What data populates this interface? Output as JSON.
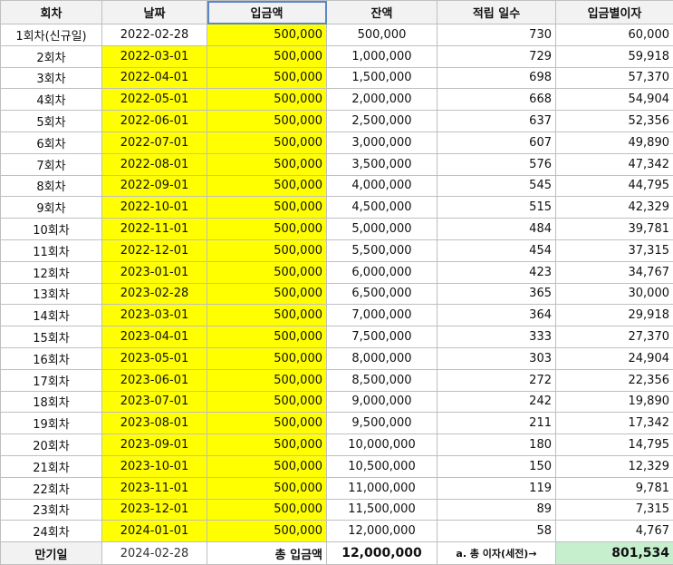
{
  "headers": [
    "회차",
    "날짜",
    "입금액",
    "잔액",
    "적립 일수",
    "입금별이자"
  ],
  "rows": [
    {
      "round": "1회차(신규일)",
      "date": "2022-02-28",
      "deposit": "500,000",
      "balance": "500,000",
      "days": "730",
      "interest": "60,000",
      "highlight_date": false
    },
    {
      "round": "2회차",
      "date": "2022-03-01",
      "deposit": "500,000",
      "balance": "1,000,000",
      "days": "729",
      "interest": "59,918",
      "highlight_date": true
    },
    {
      "round": "3회차",
      "date": "2022-04-01",
      "deposit": "500,000",
      "balance": "1,500,000",
      "days": "698",
      "interest": "57,370",
      "highlight_date": true
    },
    {
      "round": "4회차",
      "date": "2022-05-01",
      "deposit": "500,000",
      "balance": "2,000,000",
      "days": "668",
      "interest": "54,904",
      "highlight_date": true
    },
    {
      "round": "5회차",
      "date": "2022-06-01",
      "deposit": "500,000",
      "balance": "2,500,000",
      "days": "637",
      "interest": "52,356",
      "highlight_date": true
    },
    {
      "round": "6회차",
      "date": "2022-07-01",
      "deposit": "500,000",
      "balance": "3,000,000",
      "days": "607",
      "interest": "49,890",
      "highlight_date": true
    },
    {
      "round": "7회차",
      "date": "2022-08-01",
      "deposit": "500,000",
      "balance": "3,500,000",
      "days": "576",
      "interest": "47,342",
      "highlight_date": true
    },
    {
      "round": "8회차",
      "date": "2022-09-01",
      "deposit": "500,000",
      "balance": "4,000,000",
      "days": "545",
      "interest": "44,795",
      "highlight_date": true
    },
    {
      "round": "9회차",
      "date": "2022-10-01",
      "deposit": "500,000",
      "balance": "4,500,000",
      "days": "515",
      "interest": "42,329",
      "highlight_date": true
    },
    {
      "round": "10회차",
      "date": "2022-11-01",
      "deposit": "500,000",
      "balance": "5,000,000",
      "days": "484",
      "interest": "39,781",
      "highlight_date": true
    },
    {
      "round": "11회차",
      "date": "2022-12-01",
      "deposit": "500,000",
      "balance": "5,500,000",
      "days": "454",
      "interest": "37,315",
      "highlight_date": true
    },
    {
      "round": "12회차",
      "date": "2023-01-01",
      "deposit": "500,000",
      "balance": "6,000,000",
      "days": "423",
      "interest": "34,767",
      "highlight_date": true
    },
    {
      "round": "13회차",
      "date": "2023-02-28",
      "deposit": "500,000",
      "balance": "6,500,000",
      "days": "365",
      "interest": "30,000",
      "highlight_date": true
    },
    {
      "round": "14회차",
      "date": "2023-03-01",
      "deposit": "500,000",
      "balance": "7,000,000",
      "days": "364",
      "interest": "29,918",
      "highlight_date": true
    },
    {
      "round": "15회차",
      "date": "2023-04-01",
      "deposit": "500,000",
      "balance": "7,500,000",
      "days": "333",
      "interest": "27,370",
      "highlight_date": true
    },
    {
      "round": "16회차",
      "date": "2023-05-01",
      "deposit": "500,000",
      "balance": "8,000,000",
      "days": "303",
      "interest": "24,904",
      "highlight_date": true
    },
    {
      "round": "17회차",
      "date": "2023-06-01",
      "deposit": "500,000",
      "balance": "8,500,000",
      "days": "272",
      "interest": "22,356",
      "highlight_date": true
    },
    {
      "round": "18회차",
      "date": "2023-07-01",
      "deposit": "500,000",
      "balance": "9,000,000",
      "days": "242",
      "interest": "19,890",
      "highlight_date": true
    },
    {
      "round": "19회차",
      "date": "2023-08-01",
      "deposit": "500,000",
      "balance": "9,500,000",
      "days": "211",
      "interest": "17,342",
      "highlight_date": true
    },
    {
      "round": "20회차",
      "date": "2023-09-01",
      "deposit": "500,000",
      "balance": "10,000,000",
      "days": "180",
      "interest": "14,795",
      "highlight_date": true
    },
    {
      "round": "21회차",
      "date": "2023-10-01",
      "deposit": "500,000",
      "balance": "10,500,000",
      "days": "150",
      "interest": "12,329",
      "highlight_date": true
    },
    {
      "round": "22회차",
      "date": "2023-11-01",
      "deposit": "500,000",
      "balance": "11,000,000",
      "days": "119",
      "interest": "9,781",
      "highlight_date": true
    },
    {
      "round": "23회차",
      "date": "2023-12-01",
      "deposit": "500,000",
      "balance": "11,500,000",
      "days": "89",
      "interest": "7,315",
      "highlight_date": true
    },
    {
      "round": "24회차",
      "date": "2024-01-01",
      "deposit": "500,000",
      "balance": "12,000,000",
      "days": "58",
      "interest": "4,767",
      "highlight_date": true
    }
  ],
  "footer": {
    "maturity_label": "만기일",
    "maturity_date": "2024-02-28",
    "total_deposit_label": "총 입금액",
    "total_deposit": "12,000,000",
    "total_interest_label": "a. 총 이자(세전)→",
    "total_interest": "801,534"
  },
  "colors": {
    "highlight": "#ffff00",
    "interest_total_bg": "#c6efce",
    "header_bg": "#f2f2f2",
    "selection_border": "#5b86c9"
  }
}
